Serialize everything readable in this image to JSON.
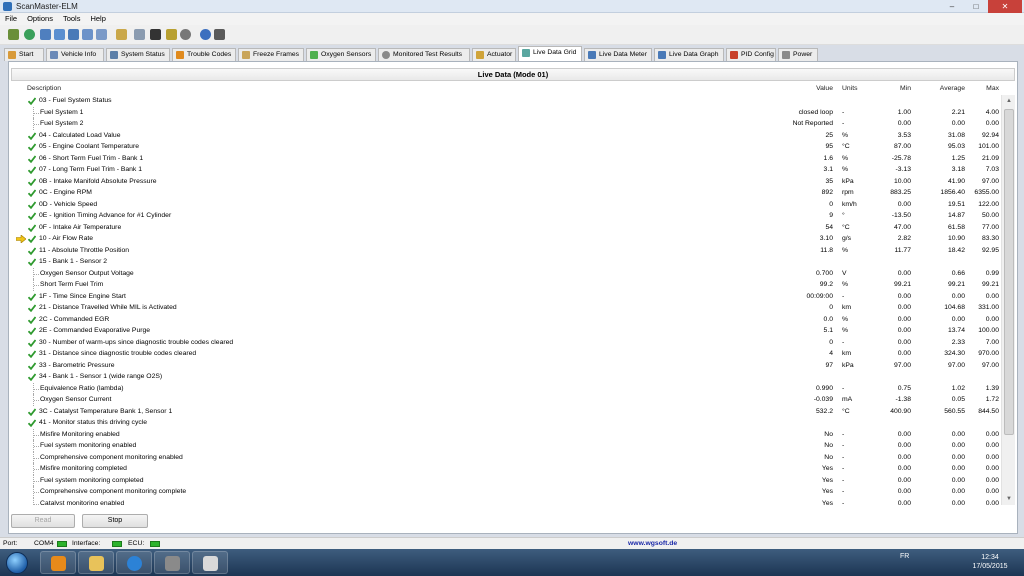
{
  "window": {
    "title": "ScanMaster-ELM"
  },
  "menu": [
    "File",
    "Options",
    "Tools",
    "Help"
  ],
  "tabs": [
    {
      "label": "Start",
      "icon": "home-icon"
    },
    {
      "label": "Vehicle Info",
      "icon": "info-icon"
    },
    {
      "label": "System Status",
      "icon": "status-icon"
    },
    {
      "label": "Trouble Codes",
      "icon": "warning-icon"
    },
    {
      "label": "Freeze Frames",
      "icon": "freeze-icon"
    },
    {
      "label": "Oxygen Sensors",
      "icon": "oxygen-icon"
    },
    {
      "label": "Monitored Test Results",
      "icon": "test-icon"
    },
    {
      "label": "Actuator",
      "icon": "actuator-icon"
    },
    {
      "label": "Live Data Grid",
      "icon": "grid-icon"
    },
    {
      "label": "Live Data Meter",
      "icon": "meter-icon"
    },
    {
      "label": "Live Data Graph",
      "icon": "graph-icon"
    },
    {
      "label": "PID Config",
      "icon": "config-icon"
    },
    {
      "label": "Power",
      "icon": "power-icon"
    }
  ],
  "panel": {
    "title": "Live Data (Mode 01)",
    "columns": {
      "description": "Description",
      "value": "Value",
      "units": "Units",
      "min": "Min",
      "average": "Average",
      "max": "Max"
    }
  },
  "rows": [
    {
      "desc": "03 - Fuel System Status",
      "value": "",
      "units": "",
      "min": "",
      "avg": "",
      "max": "",
      "check": true,
      "child": false
    },
    {
      "desc": "Fuel System 1",
      "value": "closed loop",
      "units": "-",
      "min": "1.00",
      "avg": "2.21",
      "max": "4.00",
      "check": false,
      "child": true
    },
    {
      "desc": "Fuel System 2",
      "value": "Not Reported",
      "units": "-",
      "min": "0.00",
      "avg": "0.00",
      "max": "0.00",
      "check": false,
      "child": true
    },
    {
      "desc": "04 - Calculated Load Value",
      "value": "25",
      "units": "%",
      "min": "3.53",
      "avg": "31.08",
      "max": "92.94",
      "check": true,
      "child": false
    },
    {
      "desc": "05 - Engine Coolant Temperature",
      "value": "95",
      "units": "°C",
      "min": "87.00",
      "avg": "95.03",
      "max": "101.00",
      "check": true,
      "child": false
    },
    {
      "desc": "06 - Short Term Fuel Trim - Bank 1",
      "value": "1.6",
      "units": "%",
      "min": "-25.78",
      "avg": "1.25",
      "max": "21.09",
      "check": true,
      "child": false
    },
    {
      "desc": "07 - Long Term Fuel Trim - Bank 1",
      "value": "3.1",
      "units": "%",
      "min": "-3.13",
      "avg": "3.18",
      "max": "7.03",
      "check": true,
      "child": false
    },
    {
      "desc": "0B - Intake Manifold Absolute Pressure",
      "value": "35",
      "units": "kPa",
      "min": "10.00",
      "avg": "41.90",
      "max": "97.00",
      "check": true,
      "child": false
    },
    {
      "desc": "0C - Engine RPM",
      "value": "892",
      "units": "rpm",
      "min": "883.25",
      "avg": "1856.40",
      "max": "6355.00",
      "check": true,
      "child": false
    },
    {
      "desc": "0D - Vehicle Speed",
      "value": "0",
      "units": "km/h",
      "min": "0.00",
      "avg": "19.51",
      "max": "122.00",
      "check": true,
      "child": false
    },
    {
      "desc": "0E - Ignition Timing Advance for #1 Cylinder",
      "value": "9",
      "units": "°",
      "min": "-13.50",
      "avg": "14.87",
      "max": "50.00",
      "check": true,
      "child": false
    },
    {
      "desc": "0F - Intake Air Temperature",
      "value": "54",
      "units": "°C",
      "min": "47.00",
      "avg": "61.58",
      "max": "77.00",
      "check": true,
      "child": false
    },
    {
      "desc": "10 - Air Flow Rate",
      "value": "3.10",
      "units": "g/s",
      "min": "2.82",
      "avg": "10.90",
      "max": "83.30",
      "check": true,
      "child": false,
      "pointer": true
    },
    {
      "desc": "11 - Absolute Throttle Position",
      "value": "11.8",
      "units": "%",
      "min": "11.77",
      "avg": "18.42",
      "max": "92.95",
      "check": true,
      "child": false
    },
    {
      "desc": "15 - Bank 1 - Sensor 2",
      "value": "",
      "units": "",
      "min": "",
      "avg": "",
      "max": "",
      "check": true,
      "child": false
    },
    {
      "desc": "Oxygen Sensor Output Voltage",
      "value": "0.700",
      "units": "V",
      "min": "0.00",
      "avg": "0.66",
      "max": "0.99",
      "check": false,
      "child": true
    },
    {
      "desc": "Short Term Fuel Trim",
      "value": "99.2",
      "units": "%",
      "min": "99.21",
      "avg": "99.21",
      "max": "99.21",
      "check": false,
      "child": true
    },
    {
      "desc": "1F - Time Since Engine Start",
      "value": "00:09:00",
      "units": "-",
      "min": "0.00",
      "avg": "0.00",
      "max": "0.00",
      "check": true,
      "child": false
    },
    {
      "desc": "21 - Distance Travelled While MIL is Activated",
      "value": "0",
      "units": "km",
      "min": "0.00",
      "avg": "104.68",
      "max": "331.00",
      "check": true,
      "child": false
    },
    {
      "desc": "2C - Commanded EGR",
      "value": "0.0",
      "units": "%",
      "min": "0.00",
      "avg": "0.00",
      "max": "0.00",
      "check": true,
      "child": false
    },
    {
      "desc": "2E - Commanded Evaporative Purge",
      "value": "5.1",
      "units": "%",
      "min": "0.00",
      "avg": "13.74",
      "max": "100.00",
      "check": true,
      "child": false
    },
    {
      "desc": "30 - Number of warm-ups since diagnostic trouble codes cleared",
      "value": "0",
      "units": "-",
      "min": "0.00",
      "avg": "2.33",
      "max": "7.00",
      "check": true,
      "child": false
    },
    {
      "desc": "31 - Distance since diagnostic trouble codes cleared",
      "value": "4",
      "units": "km",
      "min": "0.00",
      "avg": "324.30",
      "max": "970.00",
      "check": true,
      "child": false
    },
    {
      "desc": "33 - Barometric Pressure",
      "value": "97",
      "units": "kPa",
      "min": "97.00",
      "avg": "97.00",
      "max": "97.00",
      "check": true,
      "child": false
    },
    {
      "desc": "34 - Bank 1 - Sensor 1 (wide range O2S)",
      "value": "",
      "units": "",
      "min": "",
      "avg": "",
      "max": "",
      "check": true,
      "child": false
    },
    {
      "desc": "Equivalence Ratio (lambda)",
      "value": "0.990",
      "units": "-",
      "min": "0.75",
      "avg": "1.02",
      "max": "1.39",
      "check": false,
      "child": true
    },
    {
      "desc": "Oxygen Sensor Current",
      "value": "-0.039",
      "units": "mA",
      "min": "-1.38",
      "avg": "0.05",
      "max": "1.72",
      "check": false,
      "child": true
    },
    {
      "desc": "3C - Catalyst Temperature Bank 1, Sensor 1",
      "value": "532.2",
      "units": "°C",
      "min": "400.90",
      "avg": "560.55",
      "max": "844.50",
      "check": true,
      "child": false
    },
    {
      "desc": "41 - Monitor status this driving cycle",
      "value": "",
      "units": "",
      "min": "",
      "avg": "",
      "max": "",
      "check": true,
      "child": false
    },
    {
      "desc": "Misfire Monitoring enabled",
      "value": "No",
      "units": "-",
      "min": "0.00",
      "avg": "0.00",
      "max": "0.00",
      "check": false,
      "child": true
    },
    {
      "desc": "Fuel system monitoring enabled",
      "value": "No",
      "units": "-",
      "min": "0.00",
      "avg": "0.00",
      "max": "0.00",
      "check": false,
      "child": true
    },
    {
      "desc": "Comprehensive component monitoring enabled",
      "value": "No",
      "units": "-",
      "min": "0.00",
      "avg": "0.00",
      "max": "0.00",
      "check": false,
      "child": true
    },
    {
      "desc": "Misfire monitoring completed",
      "value": "Yes",
      "units": "-",
      "min": "0.00",
      "avg": "0.00",
      "max": "0.00",
      "check": false,
      "child": true
    },
    {
      "desc": "Fuel system monitoring completed",
      "value": "Yes",
      "units": "-",
      "min": "0.00",
      "avg": "0.00",
      "max": "0.00",
      "check": false,
      "child": true
    },
    {
      "desc": "Comprehensive component monitoring complete",
      "value": "Yes",
      "units": "-",
      "min": "0.00",
      "avg": "0.00",
      "max": "0.00",
      "check": false,
      "child": true
    },
    {
      "desc": "Catalyst monitoring enabled",
      "value": "Yes",
      "units": "-",
      "min": "0.00",
      "avg": "0.00",
      "max": "0.00",
      "check": false,
      "child": true
    }
  ],
  "buttons": {
    "read": "Read",
    "stop": "Stop"
  },
  "status": {
    "port_label": "Port:",
    "port_value": "COM4",
    "interface_label": "Interface:",
    "ecu_label": "ECU:",
    "website": "www.wgsoft.de"
  },
  "taskbar": {
    "lang": "FR",
    "time": "12:34",
    "date": "17/05/2015"
  },
  "colors": {
    "check": "#2f9a2f",
    "pointer": "#f0c419",
    "link": "#1a28a8",
    "led": "#2db32d"
  }
}
